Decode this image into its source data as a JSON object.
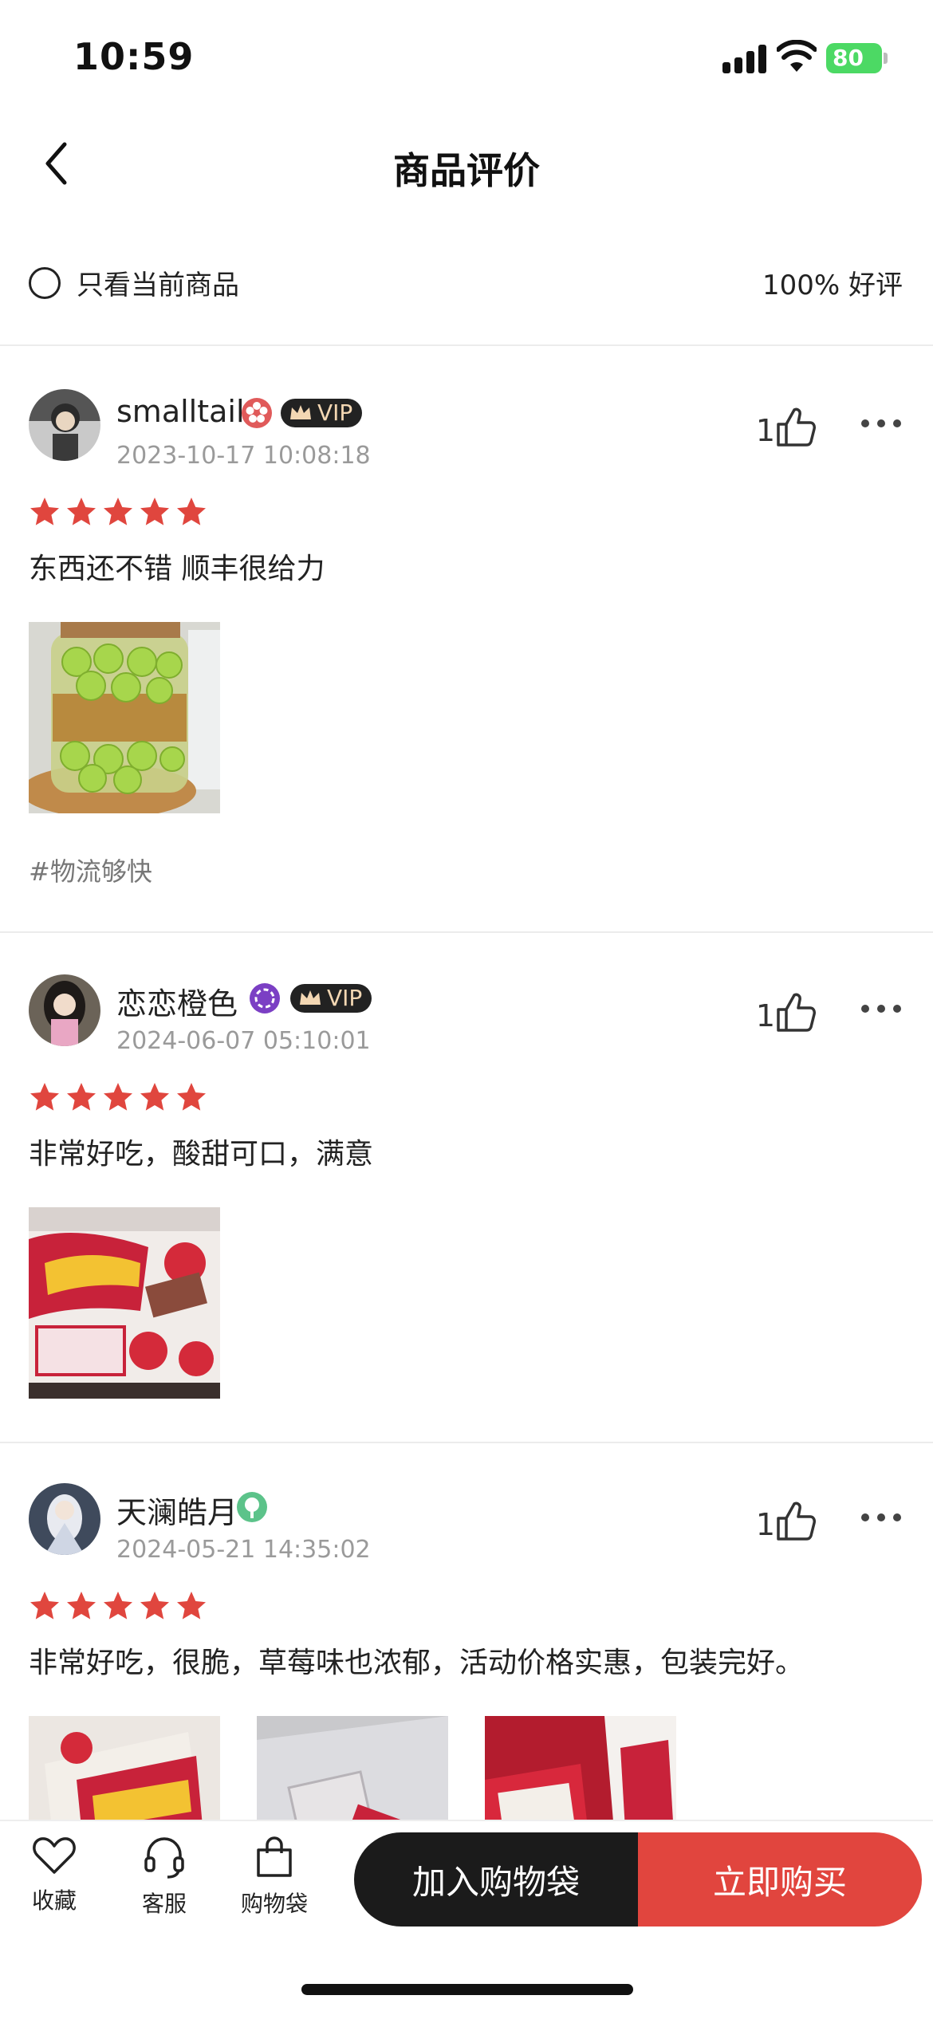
{
  "status_bar": {
    "time": "10:59",
    "battery": "80"
  },
  "nav": {
    "title": "商品评价"
  },
  "filter": {
    "label": "只看当前商品",
    "good_rate": "100% 好评"
  },
  "reviews": [
    {
      "user": "smalltail",
      "vip": "VIP",
      "badge_color": "#e05a5a",
      "time": "2023-10-17 10:08:18",
      "likes": "1",
      "rating": 5,
      "text": "东西还不错 顺丰很给力",
      "photos": [
        "jar of green plums"
      ],
      "tag": "#物流够快"
    },
    {
      "user": "恋恋橙色",
      "vip": "VIP",
      "badge_color": "#7b3fc4",
      "time": "2024-06-07 05:10:01",
      "likes": "1",
      "rating": 5,
      "text": "非常好吃，酸甜可口，满意",
      "photos": [
        "strawberry chocolate bag"
      ]
    },
    {
      "user": "天澜皓月",
      "badge_color": "#5cc38a",
      "time": "2024-05-21 14:35:02",
      "likes": "1",
      "rating": 5,
      "text": "非常好吃，很脆，草莓味也浓郁，活动价格实惠，包装完好。",
      "photos": [
        "snack bar 1",
        "snack bar 2",
        "snack bar 3"
      ]
    }
  ],
  "bottom_bar": {
    "favorite_label": "收藏",
    "service_label": "客服",
    "bag_label": "购物袋",
    "add_to_bag": "加入购物袋",
    "buy_now": "立即购买"
  },
  "colors": {
    "accent": "#e1453e",
    "star": "#e0463e",
    "dark_button": "#1b1b1b"
  }
}
